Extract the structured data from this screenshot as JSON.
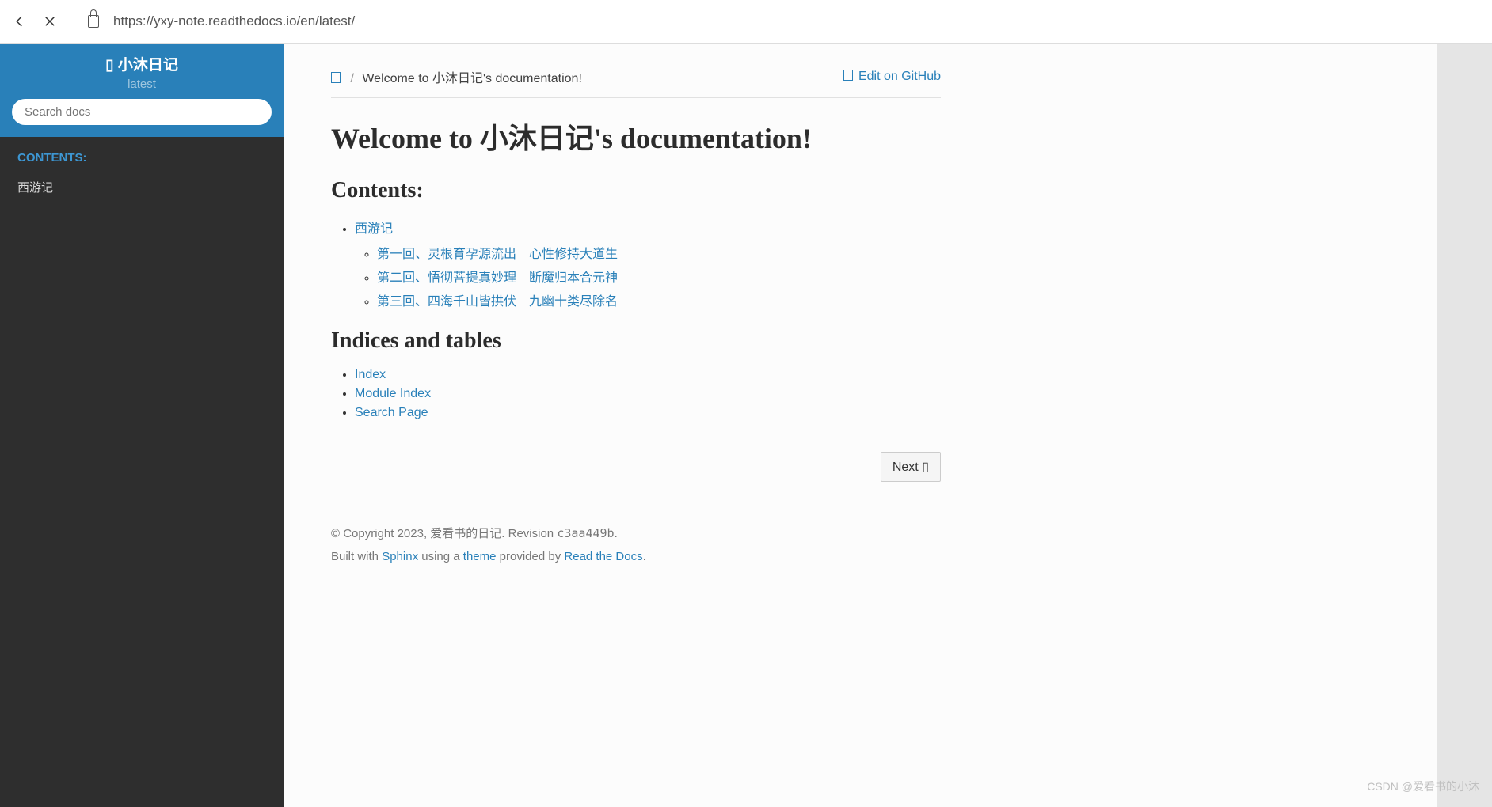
{
  "browser": {
    "url": "https://yxy-note.readthedocs.io/en/latest/"
  },
  "sidebar": {
    "title_prefix": "▯ ",
    "title": "小沐日记",
    "version": "latest",
    "search_placeholder": "Search docs",
    "caption": "CONTENTS:",
    "items": [
      "西游记"
    ]
  },
  "breadcrumb": {
    "home_glyph": "▯",
    "sep": "/",
    "current": "Welcome to 小沐日记's documentation!",
    "github_glyph": "▯",
    "github_text": "Edit on GitHub"
  },
  "main": {
    "h1": "Welcome to 小沐日记's documentation!",
    "contents_heading": "Contents:",
    "toc_parent": "西游记",
    "toc_children": [
      "第一回、灵根育孕源流出　心性修持大道生",
      "第二回、悟彻菩提真妙理　断魔归本合元神",
      "第三回、四海千山皆拱伏　九幽十类尽除名"
    ],
    "indices_heading": "Indices and tables",
    "indices_links": [
      "Index",
      "Module Index",
      "Search Page"
    ],
    "next_label": "Next ▯"
  },
  "footer": {
    "copyright_prefix": "© Copyright 2023, 爱看书的日记. Revision ",
    "revision": "c3aa449b",
    "copyright_suffix": ".",
    "built_prefix": "Built with ",
    "sphinx": "Sphinx",
    "built_mid1": " using a ",
    "theme": "theme",
    "built_mid2": " provided by ",
    "rtd": "Read the Docs",
    "built_suffix": "."
  },
  "watermark": "CSDN @爱看书的小沐"
}
